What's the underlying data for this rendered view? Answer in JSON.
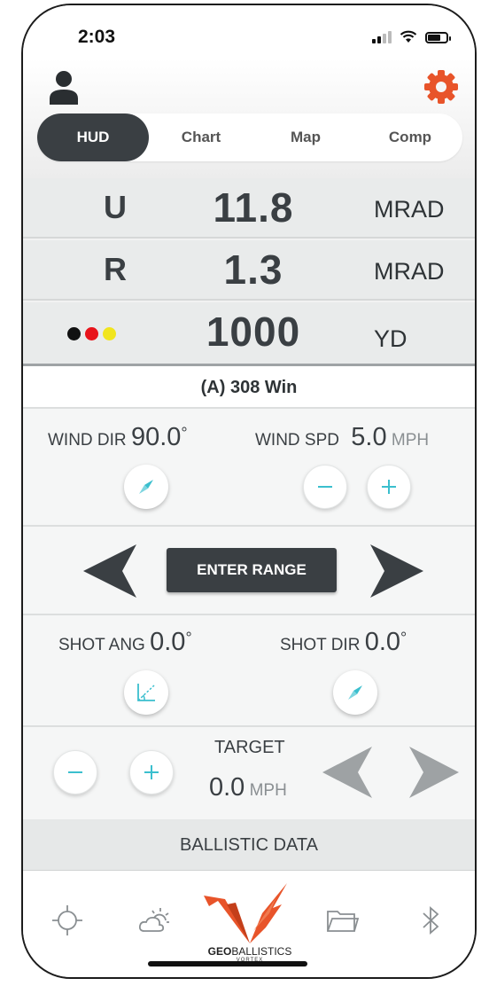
{
  "status_bar": {
    "time": "2:03"
  },
  "tabs": [
    {
      "label": "HUD",
      "active": true
    },
    {
      "label": "Chart",
      "active": false
    },
    {
      "label": "Map",
      "active": false
    },
    {
      "label": "Comp",
      "active": false
    }
  ],
  "hud": {
    "elevation": {
      "letter": "U",
      "value": "11.8",
      "unit": "MRAD"
    },
    "windage": {
      "letter": "R",
      "value": "1.3",
      "unit": "MRAD"
    },
    "range": {
      "value": "1000",
      "unit": "YD",
      "dot_colors": [
        "#111111",
        "#e8141b",
        "#f1e51d"
      ]
    }
  },
  "profile": {
    "name": "(A) 308 Win"
  },
  "wind": {
    "dir_label": "WIND DIR",
    "dir_value": "90.0",
    "degree_symbol": "°",
    "spd_label": "WIND SPD",
    "spd_value": "5.0",
    "spd_unit": "MPH"
  },
  "range_entry": {
    "button_label": "ENTER RANGE"
  },
  "shot": {
    "ang_label": "SHOT ANG",
    "ang_value": "0.0",
    "dir_label": "SHOT DIR",
    "dir_value": "0.0",
    "degree_symbol": "°"
  },
  "target": {
    "label": "TARGET",
    "value": "0.0",
    "unit": "MPH"
  },
  "ballistic": {
    "label": "BALLISTIC DATA"
  },
  "bottom_nav": {
    "icons": [
      "crosshair-icon",
      "weather-icon",
      "geoballistics-logo",
      "folder-icon",
      "bluetooth-icon"
    ],
    "logo_text_bold": "GEO",
    "logo_text_rest": "BALLISTICS",
    "logo_sub": "VORTEX"
  },
  "colors": {
    "accent": "#e8542a",
    "teal": "#3bbfce",
    "dark": "#3a3f43"
  }
}
